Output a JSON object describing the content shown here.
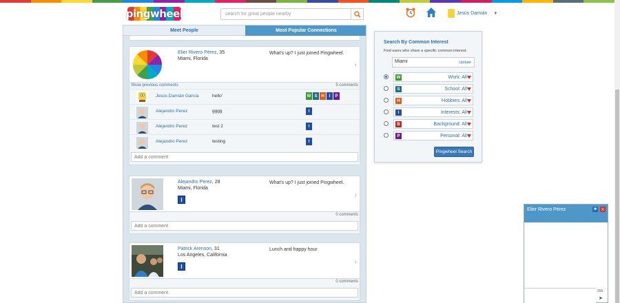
{
  "rainbow": [
    "#e53935",
    "#fb8c00",
    "#fdd835",
    "#43a047",
    "#1e88e5",
    "#8e24aa",
    "#00acc1",
    "#e91e63",
    "#6d4c41",
    "#7cb342",
    "#3949ab",
    "#f4511e",
    "#00897b",
    "#c0ca33",
    "#5e35b1",
    "#d81b60",
    "#039be5",
    "#ffb300",
    "#546e7a",
    "#8bc34a"
  ],
  "header": {
    "logo": "pingwheel",
    "search_placeholder": "search for great people nearby",
    "user_name": "Jesús Damián",
    "icons": [
      "alarm-clock-icon",
      "home-icon",
      "search-icon"
    ]
  },
  "tabs": [
    {
      "label": "Meet People"
    },
    {
      "label": "Most Popular Connections"
    }
  ],
  "posts": [
    {
      "name": "Elier Rivero Pérez",
      "age": ", 35",
      "location": "Miami, Florida",
      "message": "What's up? I just joined Pingwheel.",
      "show_previous": "Show previous comments",
      "comment_count": "5 comments",
      "comments": [
        {
          "name": "Jesús Damián García",
          "text": "hello'",
          "badges": [
            "W",
            "S",
            "H",
            "I",
            "P"
          ]
        },
        {
          "name": "Alejandro Perez",
          "text": "gggg",
          "badges": [
            "I"
          ]
        },
        {
          "name": "Alejandro Perez",
          "text": "test 2",
          "badges": [
            "I"
          ]
        },
        {
          "name": "Alejandro Perez",
          "text": "testing",
          "badges": [
            "I"
          ]
        }
      ],
      "add_placeholder": "Add a comment"
    },
    {
      "name": "Alejandro Perez",
      "age": ", 28",
      "location": "Miami, Florida",
      "message": "What's up? I just joined Pingwheel.",
      "badge": "I",
      "comment_count": "0 comments",
      "add_placeholder": "Add a comment"
    },
    {
      "name": "Patrick Arenson",
      "age": ", 31",
      "location": "Los Angeles, California",
      "message": "Lunch and happy hour",
      "badge": "I",
      "comment_count": "0 comments",
      "add_placeholder": "Add a comment"
    }
  ],
  "panel": {
    "title": "Search By Common Interest",
    "subtitle": "Find users who share a specific common interest.",
    "city": "Miami",
    "update": "Update",
    "rows": [
      {
        "letter": "W",
        "label": "Work: All",
        "color": "#3a9a2e",
        "selected": true
      },
      {
        "letter": "S",
        "label": "School: All",
        "color": "#1a6f8a",
        "selected": false
      },
      {
        "letter": "H",
        "label": "Hobbies: All",
        "color": "#e05a1c",
        "selected": false
      },
      {
        "letter": "I",
        "label": "Interests: All",
        "color": "#1f4eaa",
        "selected": false
      },
      {
        "letter": "B",
        "label": "Background: All",
        "color": "#c62828",
        "selected": false
      },
      {
        "letter": "P",
        "label": "Personal: All",
        "color": "#6a1b9a",
        "selected": false
      }
    ],
    "button": "Pingwheel Search"
  },
  "badge_colors": {
    "W": "#3a9a2e",
    "S": "#1a6f8a",
    "H": "#e05a1c",
    "I": "#1f4eaa",
    "P": "#6a1b9a"
  },
  "chat": {
    "name": "Elier Rivero Pérez",
    "count": "255"
  }
}
